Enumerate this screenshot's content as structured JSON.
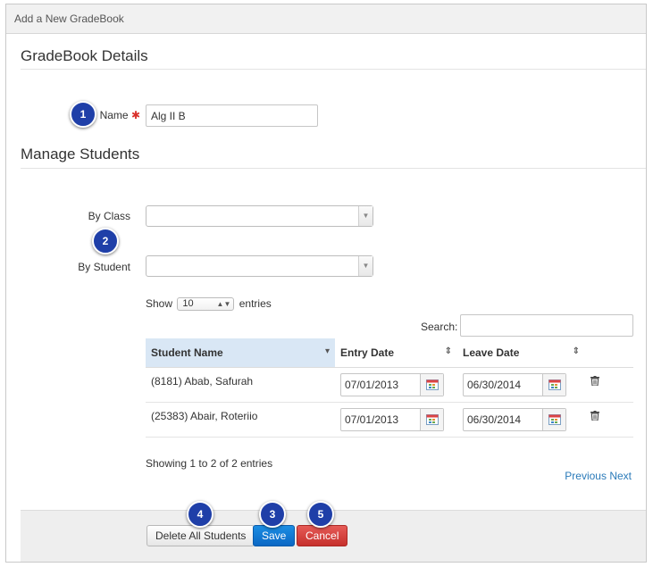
{
  "window": {
    "title": "Add a New GradeBook"
  },
  "details": {
    "heading": "GradeBook Details",
    "name_label": "Name",
    "required_mark": "✱",
    "name_value": "Alg II B"
  },
  "manage": {
    "heading": "Manage Students",
    "by_class_label": "By Class",
    "by_student_label": "By Student"
  },
  "table_controls": {
    "show_label": "Show",
    "entries_value": "10",
    "entries_label": "entries",
    "search_label": "Search:"
  },
  "table": {
    "columns": [
      "Student Name",
      "Entry Date",
      "Leave Date"
    ],
    "rows": [
      {
        "student": "(8181) Abab, Safurah",
        "entry": "07/01/2013",
        "leave": "06/30/2014"
      },
      {
        "student": "(25383) Abair, Roteriio",
        "entry": "07/01/2013",
        "leave": "06/30/2014"
      }
    ]
  },
  "table_info": "Showing 1 to 2 of 2 entries",
  "pagination": {
    "previous": "Previous",
    "next": "Next"
  },
  "buttons": {
    "delete_all": "Delete All Students",
    "save": "Save",
    "cancel": "Cancel"
  },
  "callouts": [
    "1",
    "2",
    "3",
    "4",
    "5"
  ],
  "colors": {
    "primary": "#0b67c4",
    "danger": "#c6302c",
    "badge": "#1f3fa8",
    "link": "#2a7ab9",
    "required": "#d9302b"
  },
  "icons": {
    "calendar": "calendar-icon",
    "trash": "trash-icon",
    "dropdown": "chevron-down-icon",
    "sort": "sort-icon"
  }
}
